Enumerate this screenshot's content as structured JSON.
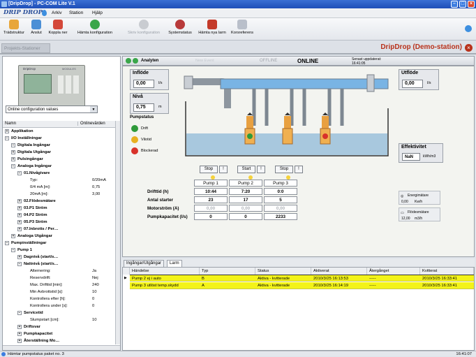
{
  "window": {
    "title": "[DripDrop] - PC-COM Lite V.1"
  },
  "menu": {
    "logo": "DRIP DROP",
    "items": [
      "Arkiv",
      "Station",
      "Hjälp"
    ]
  },
  "toolbar": {
    "items": [
      {
        "label": "Trädstruktur",
        "icon": "tree-icon"
      },
      {
        "label": "Anslut",
        "icon": "connect-icon"
      },
      {
        "label": "Koppla ner",
        "icon": "disconnect-icon"
      },
      {
        "label": "Hämta konfiguration",
        "icon": "download-icon"
      },
      {
        "label": "Skriv konfiguration",
        "icon": "upload-icon"
      },
      {
        "label": "Systemstatus",
        "icon": "system-status-icon"
      },
      {
        "label": "Hämta nya larm",
        "icon": "alarm-icon"
      },
      {
        "label": "Korsreferens",
        "icon": "crossref-icon"
      }
    ]
  },
  "projbar": {
    "tab": "Projekts-Stationer",
    "station": "DripDrop (Demo-station)"
  },
  "left": {
    "device_labels": [
      "DripDrop",
      "MODULES"
    ],
    "combo": "Online configuration values",
    "tree_header": {
      "name": "Namn",
      "value": "Onlinevärden"
    },
    "tree": [
      {
        "label": "Applikation",
        "value": "",
        "bold": true
      },
      {
        "label": "I/O Inställningar",
        "value": "",
        "bold": true
      },
      {
        "label": "Digitala Ingångar",
        "value": "",
        "bold": true
      },
      {
        "label": "Digitala Utgångar",
        "value": "",
        "bold": true
      },
      {
        "label": "Pulsingångar",
        "value": "",
        "bold": true
      },
      {
        "label": "Analoga Ingångar",
        "value": "",
        "bold": true
      },
      {
        "label": "01.Nivågivare",
        "value": "",
        "bold": true
      },
      {
        "label": "Typ:",
        "value": "0/20mA",
        "bold": false
      },
      {
        "label": "0/4 mA [m]:",
        "value": "0,75",
        "bold": false
      },
      {
        "label": "20mA [m]:",
        "value": "3,00",
        "bold": false
      },
      {
        "label": "02.Flödesmätare",
        "value": "",
        "bold": true
      },
      {
        "label": "03.P1 Ström",
        "value": "",
        "bold": true
      },
      {
        "label": "04.P2 Ström",
        "value": "",
        "bold": true
      },
      {
        "label": "05.P3 Ström",
        "value": "",
        "bold": true
      },
      {
        "label": "07.Inbrotts / Per…",
        "value": "",
        "bold": true
      },
      {
        "label": "Analoga Utgångar",
        "value": "",
        "bold": true
      },
      {
        "label": "Pumpinställningar",
        "value": "",
        "bold": true
      },
      {
        "label": "Pump 1",
        "value": "",
        "bold": true
      },
      {
        "label": "Dagnivå (start/s…",
        "value": "",
        "bold": true
      },
      {
        "label": "Nattnivå (start/s…",
        "value": "",
        "bold": true
      },
      {
        "label": "Alternering:",
        "value": "Ja",
        "bold": false
      },
      {
        "label": "Reservdrift:",
        "value": "Nej",
        "bold": false
      },
      {
        "label": "Max. Drifttid [min]:",
        "value": "240",
        "bold": false
      },
      {
        "label": "Min Avbrottstid [s]:",
        "value": "10",
        "bold": false
      },
      {
        "label": "Kontrollera efter [h]:",
        "value": "0",
        "bold": false
      },
      {
        "label": "Kontrollera under [s]:",
        "value": "0",
        "bold": false
      },
      {
        "label": "Servicetid",
        "value": "",
        "bold": true
      },
      {
        "label": "Slumpstart [cm]:",
        "value": "10",
        "bold": false
      },
      {
        "label": "Driftsvar",
        "value": "",
        "bold": true
      },
      {
        "label": "Pumpkapacitet",
        "value": "",
        "bold": true
      },
      {
        "label": "Återställning Mo…",
        "value": "",
        "bold": true
      }
    ]
  },
  "main": {
    "header": {
      "analyze": "Analyten",
      "new_event": "New Event",
      "offline": "OFFLINE",
      "online": "ONLINE",
      "last_update_label": "Senast uppdaterat:",
      "last_update": "16:41:05"
    },
    "inflow": {
      "label": "Inflöde",
      "value": "0,00",
      "unit": "l/s"
    },
    "level": {
      "label": "Nivå",
      "value": "0,75",
      "unit": "m"
    },
    "outflow": {
      "label": "Utflöde",
      "value": "0,00",
      "unit": "l/s"
    },
    "pumpstatus": {
      "title": "Pumpstatus",
      "items": [
        {
          "label": "Drift",
          "color": "#2f9a3a"
        },
        {
          "label": "Vilotid",
          "color": "#e8b020"
        },
        {
          "label": "Blockerad",
          "color": "#d8322a"
        }
      ]
    },
    "pump_buttons": [
      {
        "label": "Stop",
        "ex": "!"
      },
      {
        "label": "Start",
        "ex": "!"
      },
      {
        "label": "Stop",
        "ex": "!"
      }
    ],
    "pump_names": [
      "Pump 1",
      "Pump 2",
      "Pump 3"
    ],
    "pump_rows": [
      {
        "label": "Drifttid (h)",
        "values": [
          "10:44",
          "7:20",
          "0:0"
        ],
        "gray": false
      },
      {
        "label": "Antal starter",
        "values": [
          "23",
          "17",
          "5"
        ],
        "gray": false
      },
      {
        "label": "Motorström (A)",
        "values": [
          "0,00",
          "0,00",
          "0,00"
        ],
        "gray": true
      },
      {
        "label": "Pumpkapacitet (l/s)",
        "values": [
          "0",
          "0",
          "2233"
        ],
        "gray": false
      }
    ],
    "efficiency": {
      "label": "Effektivitet",
      "value": "NaN",
      "unit": "kWh/m3"
    },
    "energy": {
      "label": "Energimätare",
      "value": "0,00",
      "unit": "Kw/h"
    },
    "flowmeter": {
      "label": "Flödesmätare",
      "value": "12,00",
      "unit": "m3/h"
    }
  },
  "tabs": [
    "Ingångar/Utgångar",
    "Larm"
  ],
  "alarms": {
    "columns": [
      "Händelse",
      "Typ",
      "Status",
      "Aktiverat",
      "Återgånget",
      "Kvitterat"
    ],
    "rows": [
      [
        "Pump 2 ej i auto",
        "B",
        "Aktiva - kvitterade",
        "2010/3/25 16:13:53",
        "-----",
        "2010/3/25 16:33:41"
      ],
      [
        "Pump 3 utlöst temp.skydd",
        "A",
        "Aktiva - kvitterade",
        "2010/3/25 16:14:19",
        "-----",
        "2010/3/25 16:33:41"
      ]
    ]
  },
  "status": {
    "text": "Hämtar pumpstatus paket no. 3",
    "time": "16:41:07"
  }
}
